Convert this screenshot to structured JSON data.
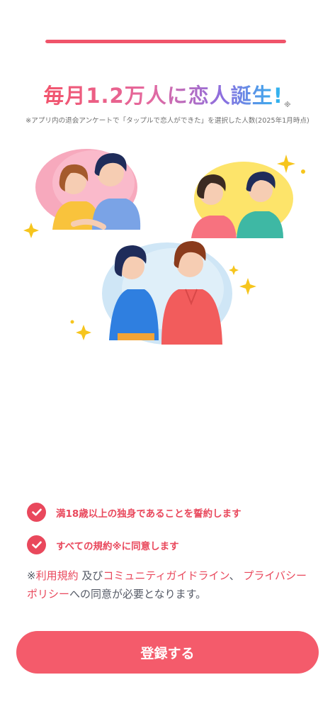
{
  "progress": {
    "value": 1.0,
    "color": "#f0546a"
  },
  "headline": {
    "text": "毎月1.2万人に恋人誕生!",
    "mark": "※"
  },
  "survey_note": "※アプリ内の退会アンケートで「タップルで恋人ができた」を選択した人数(2025年1月時点)",
  "agreements": [
    {
      "label": "満18歳以上の独身であることを誓約します",
      "checked": true
    },
    {
      "label": "すべての規約※に同意します",
      "checked": true
    }
  ],
  "terms_notice": {
    "prefix": "※",
    "terms_link": "利用規約",
    "conj1": " 及び",
    "guideline_link": "コミュニティガイドライン",
    "conj2": "、 ",
    "privacy_link": "プライバシーポリシー",
    "suffix": "への同意が必要となります。"
  },
  "register_button": {
    "label": "登録する"
  },
  "colors": {
    "accent": "#e9485c",
    "button": "#f45b6b",
    "text": "#555a66"
  }
}
